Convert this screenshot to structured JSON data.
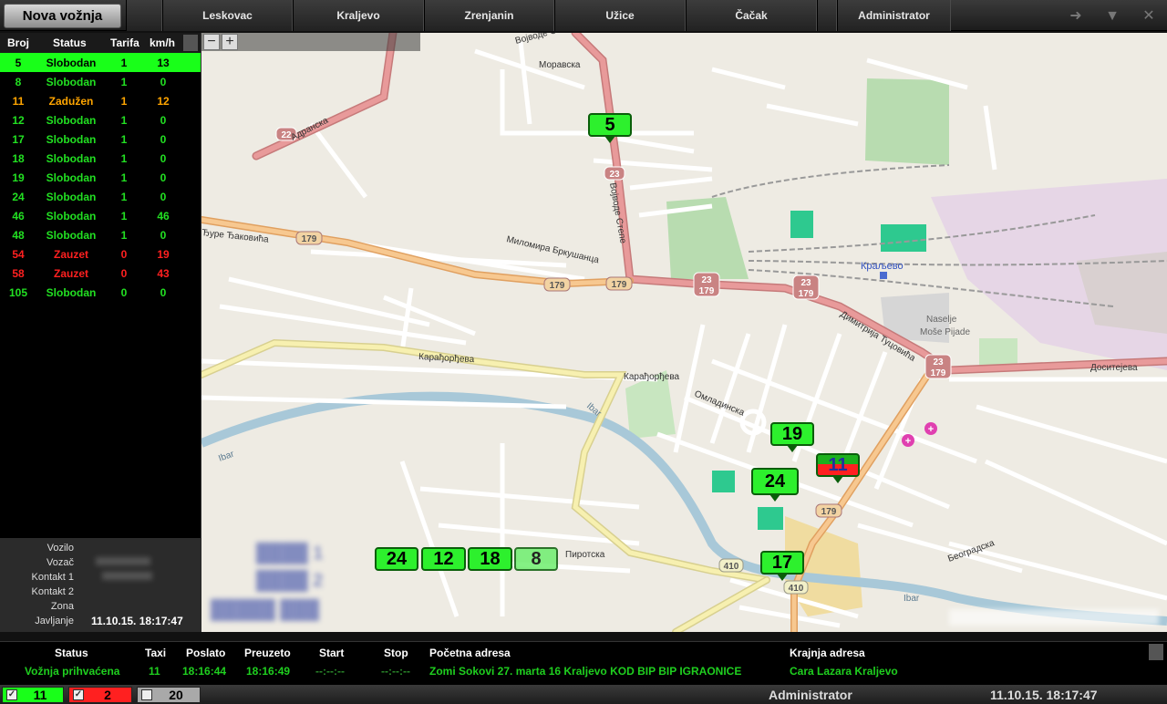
{
  "toolbar": {
    "new_ride": "Nova vožnja",
    "tabs": [
      "Leskovac",
      "Kraljevo",
      "Zrenjanin",
      "Užice",
      "Čačak",
      "Administrator"
    ]
  },
  "vehicles": {
    "headers": {
      "id": "Broj",
      "status": "Status",
      "tariff": "Tarifa",
      "speed": "km/h"
    },
    "rows": [
      {
        "id": "5",
        "status": "Slobodan",
        "tariff": "1",
        "speed": "13"
      },
      {
        "id": "8",
        "status": "Slobodan",
        "tariff": "1",
        "speed": "0"
      },
      {
        "id": "11",
        "status": "Zadužen",
        "tariff": "1",
        "speed": "12"
      },
      {
        "id": "12",
        "status": "Slobodan",
        "tariff": "1",
        "speed": "0"
      },
      {
        "id": "17",
        "status": "Slobodan",
        "tariff": "1",
        "speed": "0"
      },
      {
        "id": "18",
        "status": "Slobodan",
        "tariff": "1",
        "speed": "0"
      },
      {
        "id": "19",
        "status": "Slobodan",
        "tariff": "1",
        "speed": "0"
      },
      {
        "id": "24",
        "status": "Slobodan",
        "tariff": "1",
        "speed": "0"
      },
      {
        "id": "46",
        "status": "Slobodan",
        "tariff": "1",
        "speed": "46"
      },
      {
        "id": "48",
        "status": "Slobodan",
        "tariff": "1",
        "speed": "0"
      },
      {
        "id": "54",
        "status": "Zauzet",
        "tariff": "0",
        "speed": "19"
      },
      {
        "id": "58",
        "status": "Zauzet",
        "tariff": "0",
        "speed": "43"
      },
      {
        "id": "105",
        "status": "Slobodan",
        "tariff": "0",
        "speed": "0"
      }
    ],
    "colors": {
      "free": "#22e022",
      "assigned": "#ffa500",
      "busy": "#ff2020",
      "selected_bg": "#19ff19"
    }
  },
  "details": {
    "labels": {
      "vehicle": "Vozilo",
      "driver": "Vozač",
      "contact1": "Kontakt 1",
      "contact2": "Kontakt 2",
      "zone": "Zona",
      "report": "Javljanje"
    },
    "report_value": "11.10.15. 18:17:47"
  },
  "map": {
    "markers": [
      "5",
      "19",
      "11",
      "24",
      "17"
    ],
    "queue": [
      "24",
      "12",
      "18",
      "8"
    ],
    "zoom_icons": [
      "zoom-out",
      "zoom-in"
    ],
    "labels": {
      "adranska": "Адранска",
      "vojvode_stepe_top": "Војводе Степе",
      "vojvode_stepe": "Војводе Степе",
      "moravska": "Моравска",
      "jurija": "Ђуре Ђаковића",
      "karadjordjeva": "Карађорђева",
      "karadjordjeva2": "Карађорђева",
      "dimitrija": "Димитрија Туцовића",
      "dositejeva": "Доситејева",
      "ibar": "Ibar",
      "ibar2": "Ibar",
      "ibar3": "Ibar",
      "station": "Краљево",
      "naselje": "Naselje",
      "mose_pijade": "Moše Pijade",
      "omladinska": "Омладинска",
      "milomira": "Миломира Бркушанца",
      "pirotska": "Пиротска",
      "beogradska": "Београдска"
    },
    "shields": [
      "22",
      "23",
      "179",
      "179",
      "179",
      "23 179",
      "23 179",
      "23 179",
      "179",
      "410",
      "410"
    ]
  },
  "orders": {
    "headers": {
      "status": "Status",
      "taxi": "Taxi",
      "sent": "Poslato",
      "taken": "Preuzeto",
      "start": "Start",
      "stop": "Stop",
      "from": "Početna adresa",
      "to": "Krajnja adresa"
    },
    "row": {
      "status": "Vožnja prihvaćena",
      "taxi": "11",
      "sent": "18:16:44",
      "taken": "18:16:49",
      "start": "--:--:--",
      "stop": "--:--:--",
      "from": "Zomi Sokovi 27. marta 16 Kraljevo KOD BIP BIP IGRAONICE",
      "to": "Cara Lazara Kraljevo"
    }
  },
  "statusbar": {
    "free_count": "11",
    "busy_count": "2",
    "off_count": "20",
    "user": "Administrator",
    "datetime": "11.10.15. 18:17:47",
    "colors": {
      "free": "#19ff19",
      "busy": "#ff2020",
      "off": "#a9a9a9"
    }
  }
}
